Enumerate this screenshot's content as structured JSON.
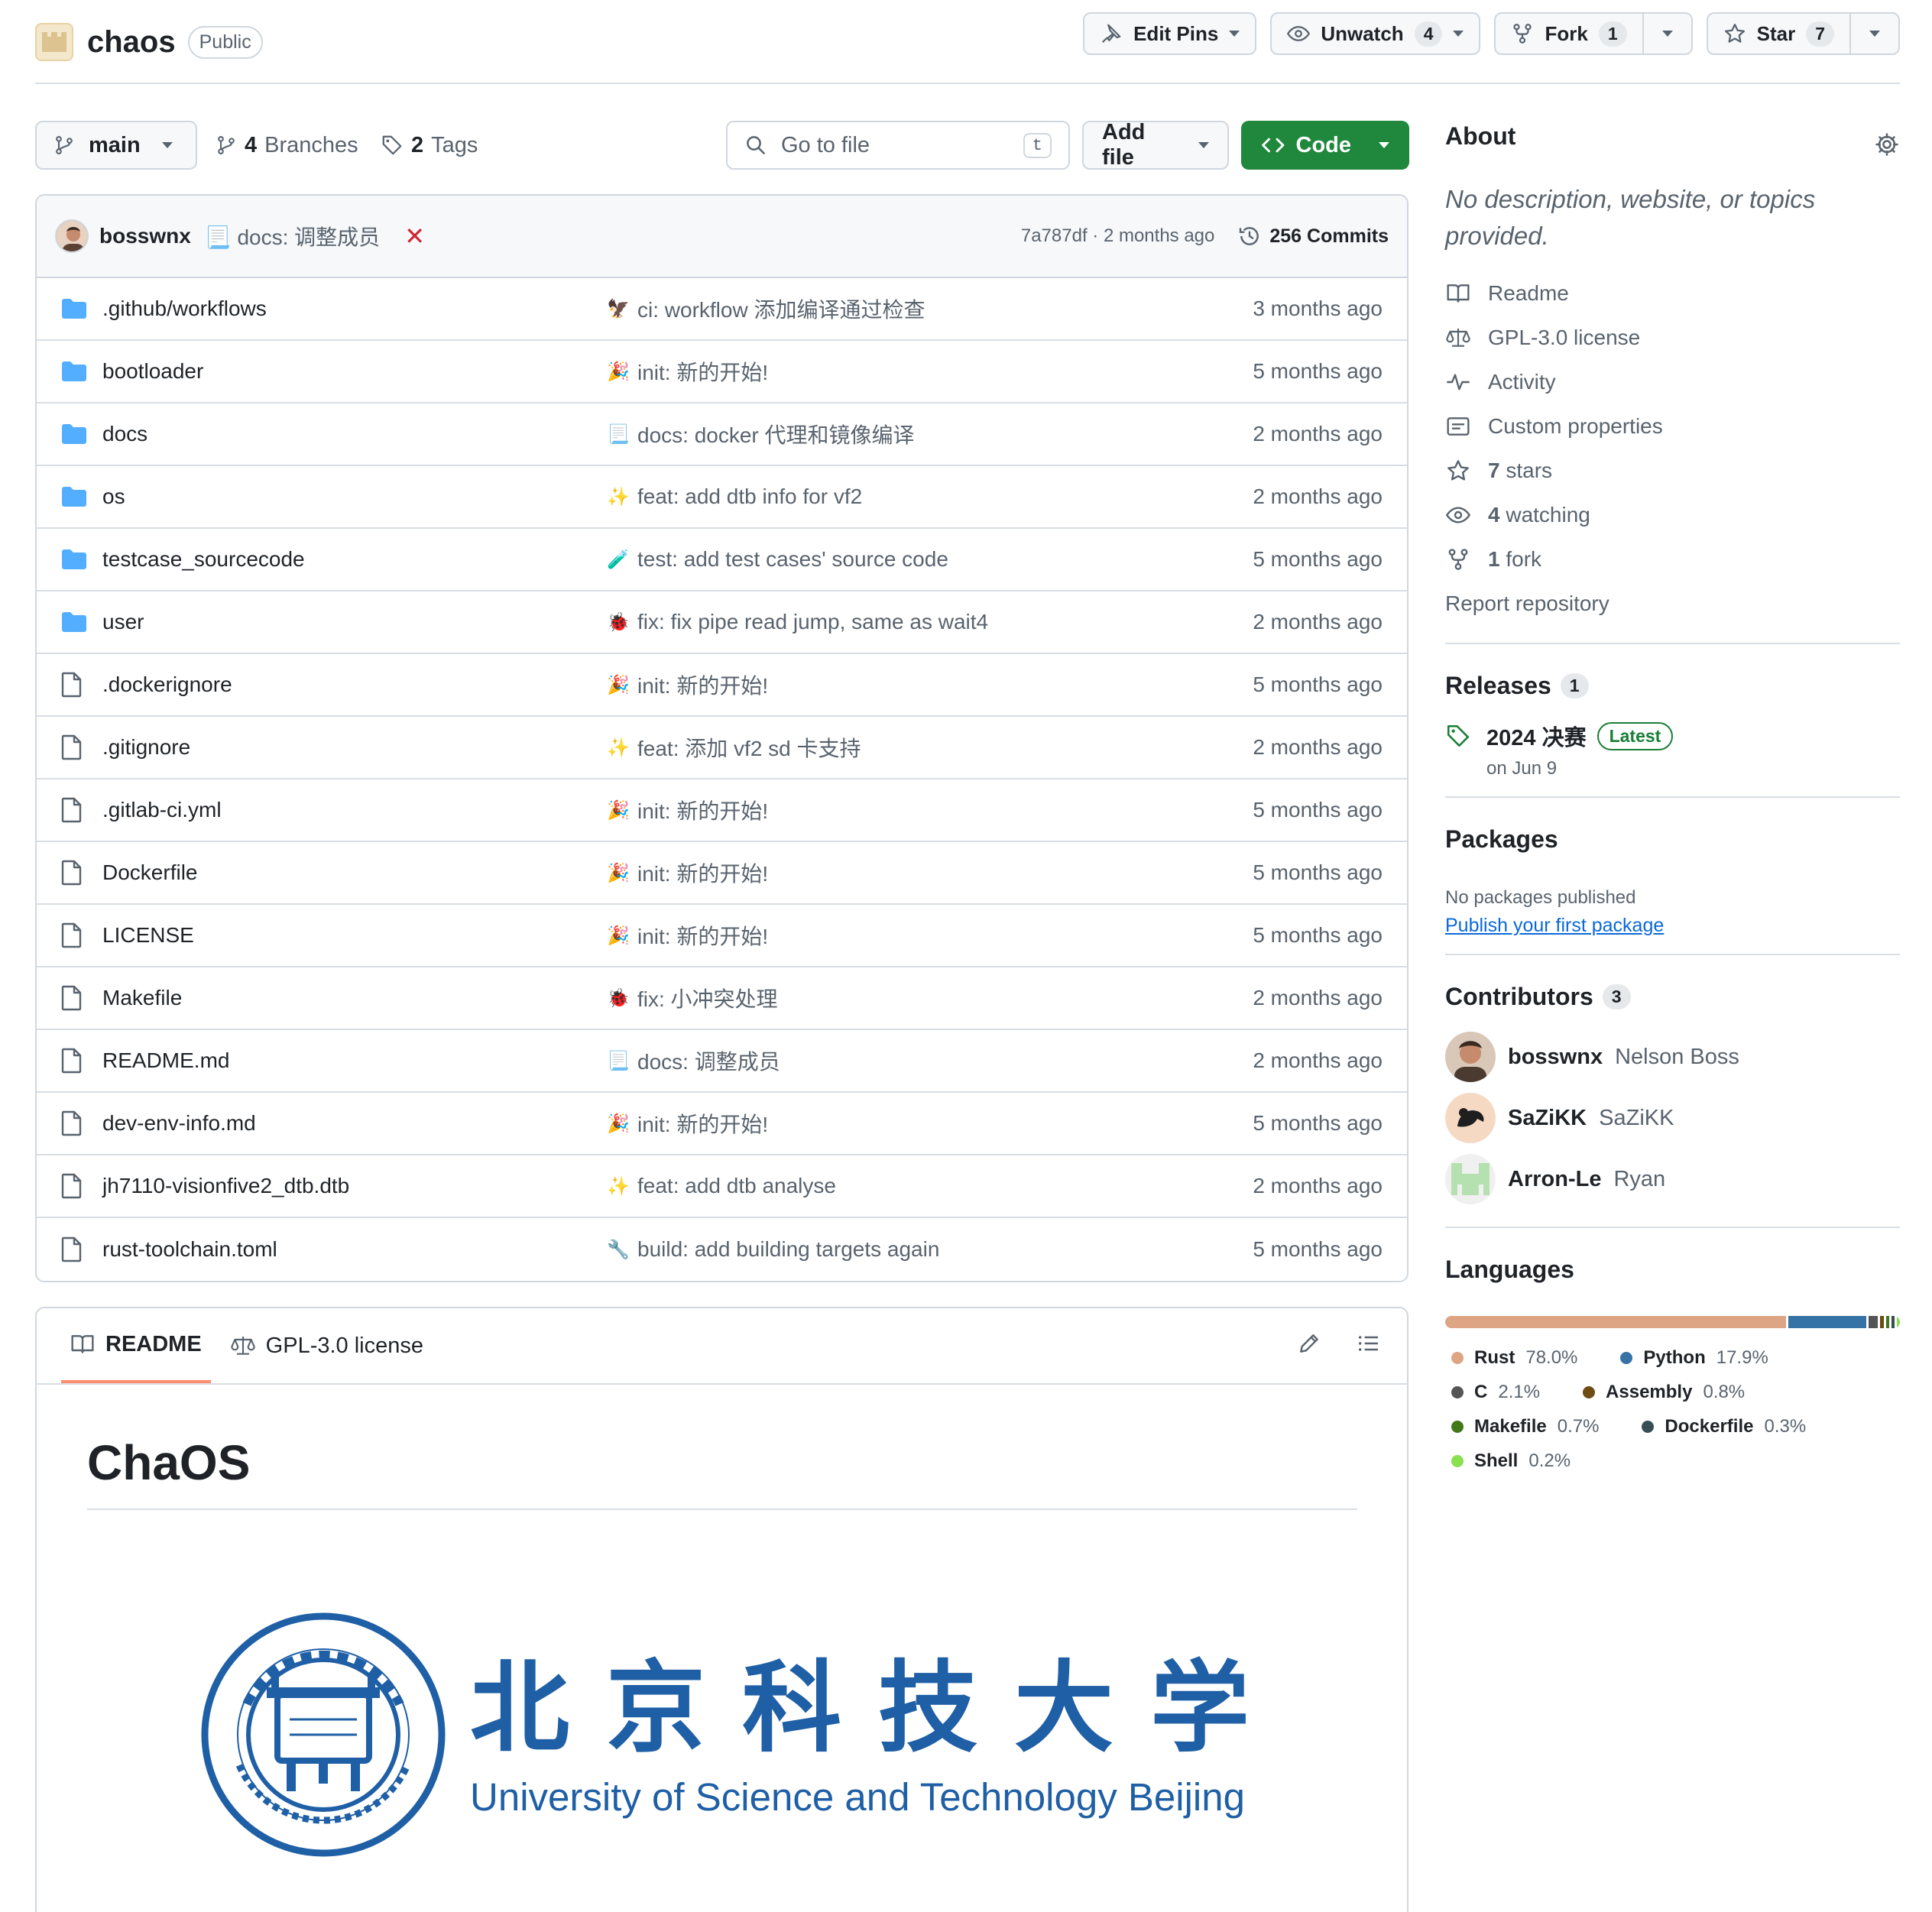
{
  "repo": {
    "name": "chaos",
    "visibility": "Public"
  },
  "header_actions": {
    "edit_pins": "Edit Pins",
    "unwatch": "Unwatch",
    "unwatch_count": "4",
    "fork": "Fork",
    "fork_count": "1",
    "star": "Star",
    "star_count": "7"
  },
  "toolbar": {
    "branch": "main",
    "branches_count": "4",
    "branches_label": "Branches",
    "tags_count": "2",
    "tags_label": "Tags",
    "goto_placeholder": "Go to file",
    "goto_shortcut": "t",
    "add_file": "Add file",
    "code": "Code"
  },
  "latest_commit": {
    "author": "bosswnx",
    "emoji": "📃",
    "message": "docs: 调整成员",
    "status": "✕",
    "hash_time": "7a787df · 2 months ago",
    "commits": "256 Commits"
  },
  "files": [
    {
      "type": "folder",
      "name": ".github/workflows",
      "emoji": "🦅",
      "message": "ci: workflow 添加编译通过检查",
      "date": "3 months ago"
    },
    {
      "type": "folder",
      "name": "bootloader",
      "emoji": "🎉",
      "message": "init: 新的开始!",
      "date": "5 months ago"
    },
    {
      "type": "folder",
      "name": "docs",
      "emoji": "📃",
      "message": "docs: docker 代理和镜像编译",
      "date": "2 months ago"
    },
    {
      "type": "folder",
      "name": "os",
      "emoji": "✨",
      "message": "feat: add dtb info for vf2",
      "date": "2 months ago"
    },
    {
      "type": "folder",
      "name": "testcase_sourcecode",
      "emoji": "🧪",
      "message": "test: add test cases' source code",
      "date": "5 months ago"
    },
    {
      "type": "folder",
      "name": "user",
      "emoji": "🐞",
      "message": "fix: fix pipe read jump, same as wait4",
      "date": "2 months ago"
    },
    {
      "type": "file",
      "name": ".dockerignore",
      "emoji": "🎉",
      "message": "init: 新的开始!",
      "date": "5 months ago"
    },
    {
      "type": "file",
      "name": ".gitignore",
      "emoji": "✨",
      "message": "feat: 添加 vf2 sd 卡支持",
      "date": "2 months ago"
    },
    {
      "type": "file",
      "name": ".gitlab-ci.yml",
      "emoji": "🎉",
      "message": "init: 新的开始!",
      "date": "5 months ago"
    },
    {
      "type": "file",
      "name": "Dockerfile",
      "emoji": "🎉",
      "message": "init: 新的开始!",
      "date": "5 months ago"
    },
    {
      "type": "file",
      "name": "LICENSE",
      "emoji": "🎉",
      "message": "init: 新的开始!",
      "date": "5 months ago"
    },
    {
      "type": "file",
      "name": "Makefile",
      "emoji": "🐞",
      "message": "fix: 小冲突处理",
      "date": "2 months ago"
    },
    {
      "type": "file",
      "name": "README.md",
      "emoji": "📃",
      "message": "docs: 调整成员",
      "date": "2 months ago"
    },
    {
      "type": "file",
      "name": "dev-env-info.md",
      "emoji": "🎉",
      "message": "init: 新的开始!",
      "date": "5 months ago"
    },
    {
      "type": "file",
      "name": "jh7110-visionfive2_dtb.dtb",
      "emoji": "✨",
      "message": "feat: add dtb analyse",
      "date": "2 months ago"
    },
    {
      "type": "file",
      "name": "rust-toolchain.toml",
      "emoji": "🔧",
      "message": "build: add building targets again",
      "date": "5 months ago"
    }
  ],
  "readme": {
    "tab_readme": "README",
    "tab_license": "GPL-3.0 license",
    "title": "ChaOS",
    "logo_cn": "北京科技大学",
    "logo_en": "University of Science and Technology Beijing"
  },
  "about": {
    "heading": "About",
    "description": "No description, website, or topics provided.",
    "items": [
      {
        "icon": "book-icon",
        "label": "Readme"
      },
      {
        "icon": "law-icon",
        "label": "GPL-3.0 license"
      },
      {
        "icon": "pulse-icon",
        "label": "Activity"
      },
      {
        "icon": "note-icon",
        "label": "Custom properties"
      },
      {
        "icon": "star-icon",
        "count": "7",
        "label": "stars"
      },
      {
        "icon": "eye-icon",
        "count": "4",
        "label": "watching"
      },
      {
        "icon": "fork-icon",
        "count": "1",
        "label": "fork"
      }
    ],
    "report": "Report repository"
  },
  "releases": {
    "heading": "Releases",
    "count": "1",
    "name": "2024 决赛",
    "badge": "Latest",
    "date": "on Jun 9"
  },
  "packages": {
    "heading": "Packages",
    "none": "No packages published",
    "link": "Publish your first package"
  },
  "contributors": {
    "heading": "Contributors",
    "count": "3",
    "list": [
      {
        "login": "bosswnx",
        "name": "Nelson Boss"
      },
      {
        "login": "SaZiKK",
        "name": "SaZiKK"
      },
      {
        "login": "Arron-Le",
        "name": "Ryan"
      }
    ]
  },
  "languages": {
    "heading": "Languages",
    "list": [
      {
        "name": "Rust",
        "percent": "78.0%",
        "value": 78.0,
        "color": "#dea584"
      },
      {
        "name": "Python",
        "percent": "17.9%",
        "value": 17.9,
        "color": "#3572A5"
      },
      {
        "name": "C",
        "percent": "2.1%",
        "value": 2.1,
        "color": "#555555"
      },
      {
        "name": "Assembly",
        "percent": "0.8%",
        "value": 0.8,
        "color": "#6E4C13"
      },
      {
        "name": "Makefile",
        "percent": "0.7%",
        "value": 0.7,
        "color": "#427819"
      },
      {
        "name": "Dockerfile",
        "percent": "0.3%",
        "value": 0.3,
        "color": "#384d54"
      },
      {
        "name": "Shell",
        "percent": "0.2%",
        "value": 0.2,
        "color": "#89e051"
      }
    ]
  }
}
